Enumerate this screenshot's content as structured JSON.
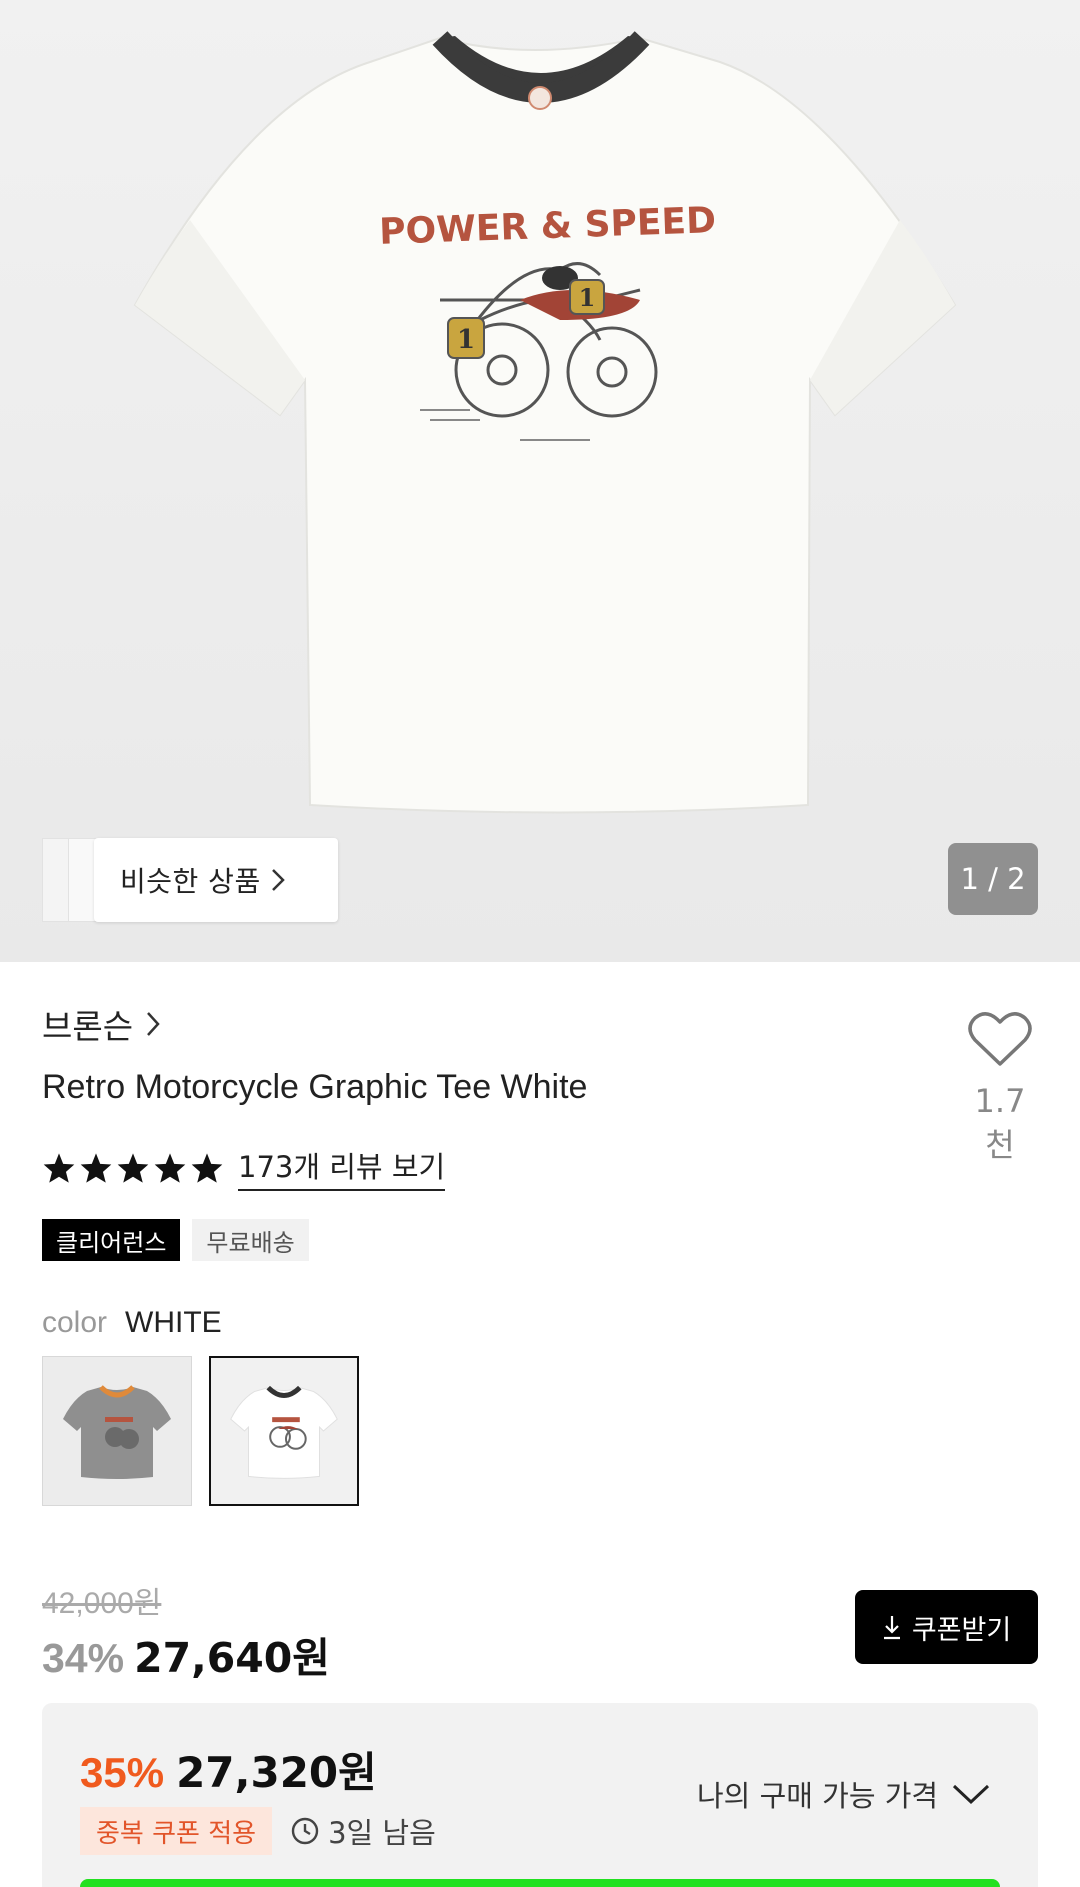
{
  "gallery": {
    "similar_label": "비슷한 상품",
    "pager": "1 / 2",
    "print_text": "POWER & SPEED",
    "race_number": "1"
  },
  "product": {
    "brand": "브론슨",
    "title": "Retro Motorcycle Graphic Tee White",
    "like_count": "1.7천",
    "rating_stars": 5,
    "review_link": "173개 리뷰 보기",
    "badges": [
      "클리어런스",
      "무료배송"
    ]
  },
  "options": {
    "color_label": "color",
    "color_value": "WHITE",
    "swatches": [
      {
        "name": "grey",
        "collar": "#e08a3a",
        "body": "#8f8f8f"
      },
      {
        "name": "white",
        "collar": "#333333",
        "body": "#ffffff"
      }
    ]
  },
  "pricing": {
    "original": "42,000원",
    "discount": "34%",
    "sale": "27,640원",
    "coupon_button": "쿠폰받기"
  },
  "best_price": {
    "discount": "35%",
    "price": "27,320원",
    "coupon_badge": "중복 쿠폰 적용",
    "time_left": "3일 남음",
    "toggle_label": "나의 구매 가능 가격"
  },
  "colors": {
    "accent_orange": "#f05a1e",
    "cta_green": "#22e020",
    "dark": "#000000"
  }
}
